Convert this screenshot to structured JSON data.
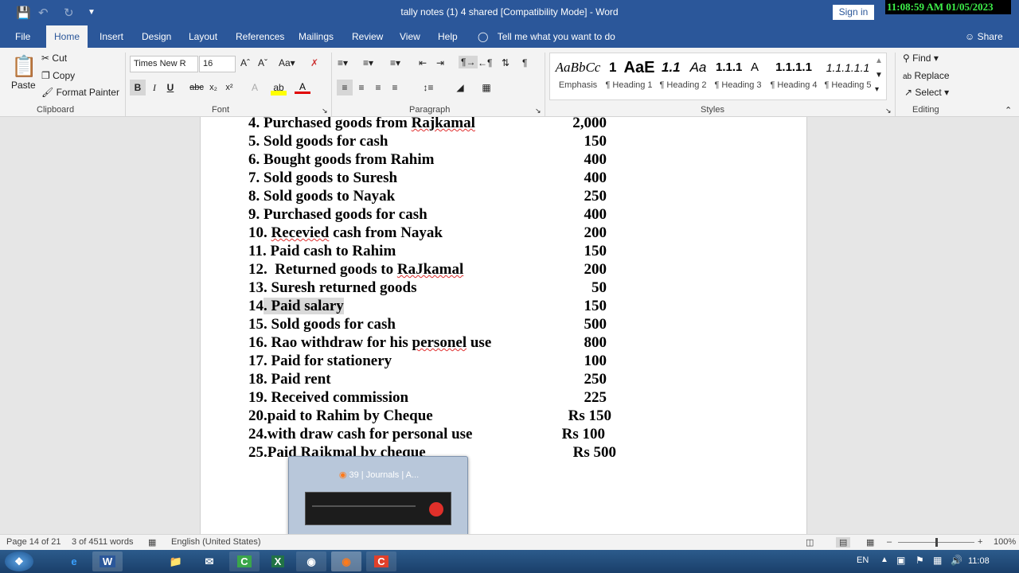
{
  "title_bar": {
    "doc_title": "tally notes (1) 4 shared [Compatibility Mode]  -  Word",
    "sign_in": "Sign in",
    "clock": "11:08:59 AM 01/05/2023"
  },
  "tabs": [
    "File",
    "Home",
    "Insert",
    "Design",
    "Layout",
    "References",
    "Mailings",
    "Review",
    "View",
    "Help"
  ],
  "tell_me": "Tell me what you want to do",
  "share": "Share",
  "clipboard": {
    "paste": "Paste",
    "cut": "Cut",
    "copy": "Copy",
    "format_painter": "Format Painter",
    "label": "Clipboard"
  },
  "font": {
    "name": "Times New R",
    "size": "16",
    "label": "Font"
  },
  "paragraph": {
    "label": "Paragraph"
  },
  "styles": {
    "label": "Styles",
    "items": [
      {
        "preview": "AaBbCc",
        "name": "Emphasis"
      },
      {
        "preview": "1",
        "name": "¶ Heading 1"
      },
      {
        "preview": "AaE",
        "name": "¶ Heading 2"
      },
      {
        "preview": "1.1",
        "name": "¶ Heading 3"
      },
      {
        "preview": "Aa",
        "name": "¶ Heading 4"
      },
      {
        "preview": "1.1.1",
        "name": "¶ Heading 5"
      },
      {
        "preview": "A",
        "name": ""
      },
      {
        "preview": "1.1.1.1",
        "name": ""
      },
      {
        "preview": "1.1.1.1.1",
        "name": ""
      }
    ]
  },
  "editing": {
    "find": "Find",
    "replace": "Replace",
    "select": "Select",
    "label": "Editing"
  },
  "document_lines": [
    {
      "text": "4. Purchased goods from Rajkamal",
      "amount": "2,000"
    },
    {
      "text": "5. Sold goods for cash",
      "amount": "150"
    },
    {
      "text": "6. Bought goods from Rahim",
      "amount": "400"
    },
    {
      "text": "7. Sold goods to Suresh",
      "amount": "400"
    },
    {
      "text": "8. Sold goods to Nayak",
      "amount": "250"
    },
    {
      "text": "9. Purchased goods for cash",
      "amount": "400"
    },
    {
      "text": "10. Recevied cash from Nayak",
      "amount": "200"
    },
    {
      "text": "11. Paid cash to Rahim",
      "amount": "150"
    },
    {
      "text": "12.  Returned goods to RaJkamal",
      "amount": "200"
    },
    {
      "text": "13. Suresh returned goods",
      "amount": "50"
    },
    {
      "text": "14. Paid salary",
      "amount": "150"
    },
    {
      "text": "15. Sold goods for cash",
      "amount": "500"
    },
    {
      "text": "16. Rao withdraw for his personel use",
      "amount": "800"
    },
    {
      "text": "17. Paid for stationery",
      "amount": "100"
    },
    {
      "text": "18. Paid rent",
      "amount": "250"
    },
    {
      "text": "19. Received commission",
      "amount": "225"
    },
    {
      "text": "20.paid to Rahim by Cheque",
      "amount": "Rs 150"
    },
    {
      "text": "24.with draw cash for personal use",
      "amount": "Rs 100"
    },
    {
      "text": "25.Paid Rajkmal by cheque",
      "amount": "Rs 500"
    }
  ],
  "status_bar": {
    "page": "Page 14 of 21",
    "words": "3 of 4511 words",
    "language": "English (United States)",
    "zoom": "100%"
  },
  "taskbar": {
    "popup_title": "39 | Journals | A...",
    "lang": "EN",
    "time": "11:08"
  }
}
